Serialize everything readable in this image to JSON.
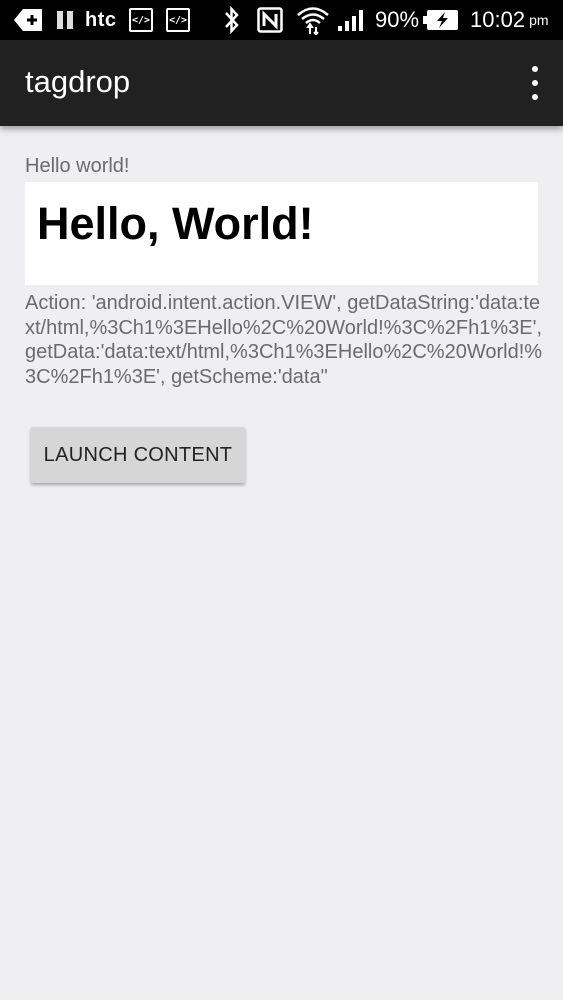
{
  "status_bar": {
    "left_icons": [
      "back-plus-icon",
      "pause-icon",
      "htc-logo",
      "code-icon",
      "code-icon"
    ],
    "htc_text": "htc",
    "code_icon_text": "</>",
    "right_icons": [
      "bluetooth-icon",
      "nfc-icon",
      "wifi-icon",
      "signal-icon",
      "battery-charging-icon"
    ],
    "battery_percent": "90%",
    "time": "10:02",
    "time_suffix": "pm"
  },
  "app_bar": {
    "title": "tagdrop",
    "menu_icon": "overflow-menu-icon"
  },
  "content": {
    "hello_label": "Hello world!",
    "webview_heading": "Hello, World!",
    "intent_info": "Action: 'android.intent.action.VIEW', getDataString:'data:text/html,%3Ch1%3EHello%2C%20World!%3C%2Fh1%3E', getData:'data:text/html,%3Ch1%3EHello%2C%20World!%3C%2Fh1%3E', getScheme:'data\"",
    "launch_button": "LAUNCH CONTENT"
  },
  "colors": {
    "status_bar_bg": "#000000",
    "app_bar_bg": "#212121",
    "background": "#efeef0",
    "secondary_text": "#6b6b6b",
    "button_bg": "#d6d6d6"
  }
}
